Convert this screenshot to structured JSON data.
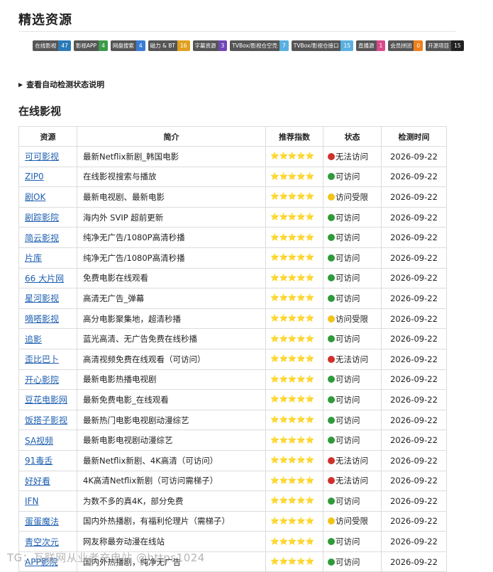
{
  "page": {
    "title": "精选资源",
    "disclosure": "查看自动检测状态说明",
    "section_title": "在线影视",
    "watermark": "TG：互联网从业者充电站 @https1024"
  },
  "tags": [
    {
      "label": "在线影视",
      "count": "47",
      "color": "#2a7ab8"
    },
    {
      "label": "影视APP",
      "count": "4",
      "color": "#3c9a4b"
    },
    {
      "label": "网盘搜索",
      "count": "4",
      "color": "#3a7bd5"
    },
    {
      "label": "磁力 & BT",
      "count": "16",
      "color": "#e0a020"
    },
    {
      "label": "字幕资源",
      "count": "3",
      "color": "#7048b8"
    },
    {
      "label": "TVBox/影视仓空壳",
      "count": "7",
      "color": "#5ab0e0"
    },
    {
      "label": "TVBox/影视仓接口",
      "count": "15",
      "color": "#5ab0e0"
    },
    {
      "label": "直播源",
      "count": "1",
      "color": "#d84a8c"
    },
    {
      "label": "会员拼团",
      "count": "0",
      "color": "#ef7f1a"
    },
    {
      "label": "开源项目",
      "count": "15",
      "color": "#222222"
    }
  ],
  "table": {
    "headers": {
      "name": "资源",
      "desc": "简介",
      "rating": "推荐指数",
      "status": "状态",
      "checked": "检测时间"
    },
    "status_colors": {
      "ok": "#2f9a3a",
      "limited": "#f0c419",
      "down": "#d0302a"
    },
    "rows": [
      {
        "name": "可可影视",
        "desc": "最新Netflix新剧_韩国电影",
        "rating": "⭐⭐⭐⭐⭐",
        "status": "无法访问",
        "state": "down",
        "date": "2026-09-22"
      },
      {
        "name": "ZIP0",
        "desc": "在线影视搜索与播放",
        "rating": "⭐⭐⭐⭐⭐",
        "status": "可访问",
        "state": "ok",
        "date": "2026-09-22"
      },
      {
        "name": "剧OK",
        "desc": "最新电视剧、最新电影",
        "rating": "⭐⭐⭐⭐⭐",
        "status": "访问受限",
        "state": "limited",
        "date": "2026-09-22"
      },
      {
        "name": "剧踪影院",
        "desc": "海内外 SVIP 超前更新",
        "rating": "⭐⭐⭐⭐⭐",
        "status": "可访问",
        "state": "ok",
        "date": "2026-09-22"
      },
      {
        "name": "简云影视",
        "desc": "纯净无广告/1080P高清秒播",
        "rating": "⭐⭐⭐⭐⭐",
        "status": "可访问",
        "state": "ok",
        "date": "2026-09-22"
      },
      {
        "name": "片库",
        "desc": "纯净无广告/1080P高清秒播",
        "rating": "⭐⭐⭐⭐⭐",
        "status": "可访问",
        "state": "ok",
        "date": "2026-09-22"
      },
      {
        "name": "66 大片网",
        "desc": "免费电影在线观看",
        "rating": "⭐⭐⭐⭐⭐",
        "status": "可访问",
        "state": "ok",
        "date": "2026-09-22"
      },
      {
        "name": "星河影视",
        "desc": "高清无广告_弹幕",
        "rating": "⭐⭐⭐⭐⭐",
        "status": "可访问",
        "state": "ok",
        "date": "2026-09-22"
      },
      {
        "name": "嘀嗒影视",
        "desc": "高分电影聚集地，超清秒播",
        "rating": "⭐⭐⭐⭐⭐",
        "status": "访问受限",
        "state": "limited",
        "date": "2026-09-22"
      },
      {
        "name": "追影",
        "desc": "蓝光高清、无广告免费在线秒播",
        "rating": "⭐⭐⭐⭐⭐",
        "status": "可访问",
        "state": "ok",
        "date": "2026-09-22"
      },
      {
        "name": "歪比巴卜",
        "desc": "高清视频免费在线观看（可访问）",
        "rating": "⭐⭐⭐⭐⭐",
        "status": "无法访问",
        "state": "down",
        "date": "2026-09-22"
      },
      {
        "name": "开心影院",
        "desc": "最新电影热播电视剧",
        "rating": "⭐⭐⭐⭐⭐",
        "status": "可访问",
        "state": "ok",
        "date": "2026-09-22"
      },
      {
        "name": "豆花电影网",
        "desc": "最新免费电影_在线观看",
        "rating": "⭐⭐⭐⭐⭐",
        "status": "可访问",
        "state": "ok",
        "date": "2026-09-22"
      },
      {
        "name": "饭搭子影视",
        "desc": "最新热门电影电视剧动漫综艺",
        "rating": "⭐⭐⭐⭐⭐",
        "status": "可访问",
        "state": "ok",
        "date": "2026-09-22"
      },
      {
        "name": "SA视频",
        "desc": "最新电影电视剧动漫综艺",
        "rating": "⭐⭐⭐⭐⭐",
        "status": "可访问",
        "state": "ok",
        "date": "2026-09-22"
      },
      {
        "name": "91毒舌",
        "desc": "最新Netflix新剧、4K高清（可访问）",
        "rating": "⭐⭐⭐⭐⭐",
        "status": "无法访问",
        "state": "down",
        "date": "2026-09-22"
      },
      {
        "name": "好好看",
        "desc": "4K高清Netflix新剧（可访问需梯子）",
        "rating": "⭐⭐⭐⭐⭐",
        "status": "无法访问",
        "state": "down",
        "date": "2026-09-22"
      },
      {
        "name": "IFN",
        "desc": "为数不多的真4K，部分免费",
        "rating": "⭐⭐⭐⭐⭐",
        "status": "可访问",
        "state": "ok",
        "date": "2026-09-22"
      },
      {
        "name": "蛋蛋魔法",
        "desc": "国内外热播剧，有福利伦理片（需梯子）",
        "rating": "⭐⭐⭐⭐⭐",
        "status": "访问受限",
        "state": "limited",
        "date": "2026-09-22"
      },
      {
        "name": "青空次元",
        "desc": "网友称最夯动漫在线站",
        "rating": "⭐⭐⭐⭐⭐",
        "status": "可访问",
        "state": "ok",
        "date": "2026-09-22"
      },
      {
        "name": "APP影院",
        "desc": "国内外热播剧，纯净无广告",
        "rating": "⭐⭐⭐⭐⭐",
        "status": "可访问",
        "state": "ok",
        "date": "2026-09-22"
      }
    ]
  }
}
